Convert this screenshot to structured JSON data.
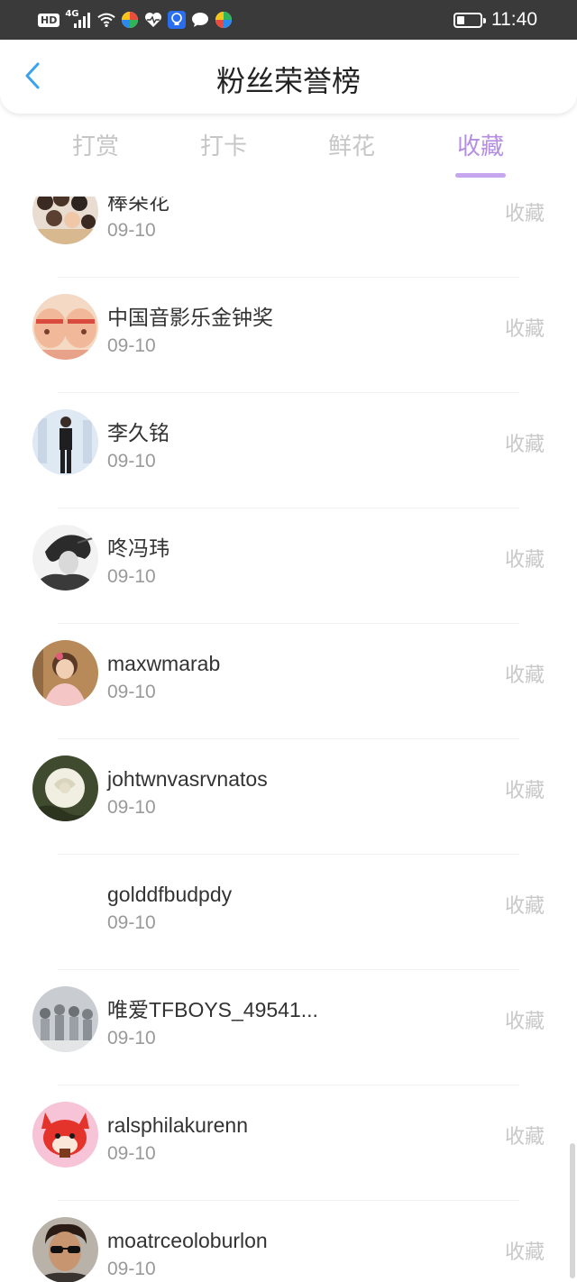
{
  "status_bar": {
    "hd": "HD",
    "network": "4G",
    "signal_level": 4,
    "time": "11:40",
    "battery_level": 0.35,
    "icons": [
      "wifi-icon",
      "colorful-app-icon",
      "health-heart-icon",
      "bulb-icon",
      "chat-bubble-icon",
      "colorful-app-icon-2"
    ]
  },
  "header": {
    "back_icon": "chevron-left-icon",
    "title": "粉丝荣誉榜"
  },
  "tabs": [
    {
      "label": "打赏",
      "active": false
    },
    {
      "label": "打卡",
      "active": false
    },
    {
      "label": "鲜花",
      "active": false
    },
    {
      "label": "收藏",
      "active": true
    }
  ],
  "colors": {
    "accent": "#b48ee0",
    "accent_underline": "#c5a6ef",
    "back_icon": "#3aa3ef",
    "status_bar": "#3a3a3a"
  },
  "list": [
    {
      "name": "棒朵花",
      "date": "09-10",
      "action": "收藏",
      "avatar": "group-photo-avatar"
    },
    {
      "name": "中国音影乐金钟奖",
      "date": "09-10",
      "action": "收藏",
      "avatar": "cartoon-faces-avatar"
    },
    {
      "name": "李久铭",
      "date": "09-10",
      "action": "收藏",
      "avatar": "standing-man-avatar"
    },
    {
      "name": "咚冯玮",
      "date": "09-10",
      "action": "收藏",
      "avatar": "sketch-portrait-avatar"
    },
    {
      "name": "maxwmarab",
      "date": "09-10",
      "action": "收藏",
      "avatar": "child-photo-avatar"
    },
    {
      "name": "johtwnvasrvnatos",
      "date": "09-10",
      "action": "收藏",
      "avatar": "white-rose-avatar"
    },
    {
      "name": "golddfbudpdy",
      "date": "09-10",
      "action": "收藏",
      "avatar": "blank-avatar"
    },
    {
      "name": "唯爱TFBOYS_49541...",
      "date": "09-10",
      "action": "收藏",
      "avatar": "group-grey-avatar"
    },
    {
      "name": "ralsphilakurenn",
      "date": "09-10",
      "action": "收藏",
      "avatar": "red-fox-cartoon-avatar"
    },
    {
      "name": "moatrceoloburlon",
      "date": "09-10",
      "action": "收藏",
      "avatar": "sunglasses-man-avatar"
    }
  ]
}
